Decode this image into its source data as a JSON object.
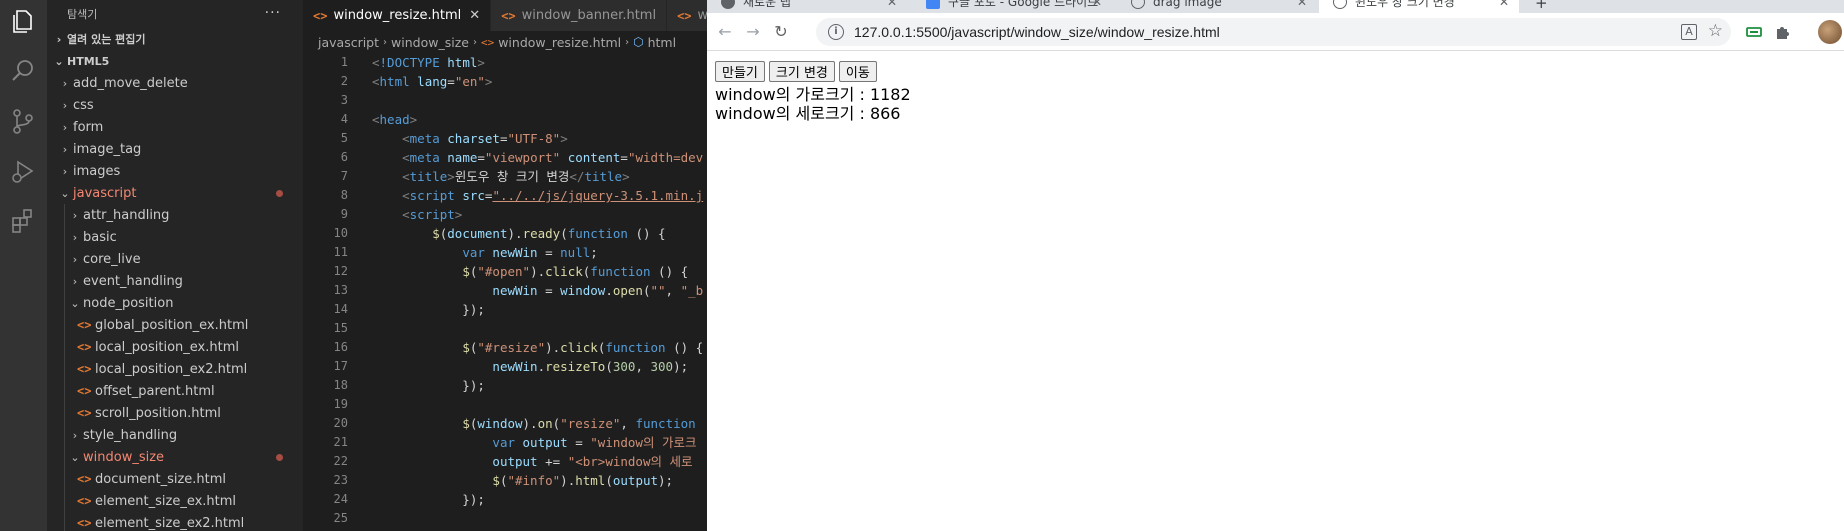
{
  "vscode": {
    "sidebar": {
      "title": "탐색기",
      "more": "···",
      "open_editors": "열려 있는 편집기",
      "root": "HTML5",
      "items": [
        {
          "label": "add_move_delete",
          "type": "folder",
          "depth": 1,
          "open": false
        },
        {
          "label": "css",
          "type": "folder",
          "depth": 1,
          "open": false
        },
        {
          "label": "form",
          "type": "folder",
          "depth": 1,
          "open": false
        },
        {
          "label": "image_tag",
          "type": "folder",
          "depth": 1,
          "open": false
        },
        {
          "label": "images",
          "type": "folder",
          "depth": 1,
          "open": false
        },
        {
          "label": "javascript",
          "type": "folder",
          "depth": 1,
          "open": true,
          "modified": true
        },
        {
          "label": "attr_handling",
          "type": "folder",
          "depth": 2,
          "open": false
        },
        {
          "label": "basic",
          "type": "folder",
          "depth": 2,
          "open": false
        },
        {
          "label": "core_live",
          "type": "folder",
          "depth": 2,
          "open": false
        },
        {
          "label": "event_handling",
          "type": "folder",
          "depth": 2,
          "open": false
        },
        {
          "label": "node_position",
          "type": "folder",
          "depth": 2,
          "open": true
        },
        {
          "label": "global_position_ex.html",
          "type": "file",
          "depth": 3
        },
        {
          "label": "local_position_ex.html",
          "type": "file",
          "depth": 3
        },
        {
          "label": "local_position_ex2.html",
          "type": "file",
          "depth": 3
        },
        {
          "label": "offset_parent.html",
          "type": "file",
          "depth": 3
        },
        {
          "label": "scroll_position.html",
          "type": "file",
          "depth": 3
        },
        {
          "label": "style_handling",
          "type": "folder",
          "depth": 2,
          "open": false
        },
        {
          "label": "window_size",
          "type": "folder",
          "depth": 2,
          "open": true,
          "modified": true
        },
        {
          "label": "document_size.html",
          "type": "file",
          "depth": 3
        },
        {
          "label": "element_size_ex.html",
          "type": "file",
          "depth": 3
        },
        {
          "label": "element_size_ex2.html",
          "type": "file",
          "depth": 3
        }
      ]
    },
    "tabs": [
      {
        "label": "window_resize.html",
        "active": true,
        "close": "✕"
      },
      {
        "label": "window_banner.html",
        "active": false
      },
      {
        "label": "wi",
        "active": false
      }
    ],
    "breadcrumb": [
      "javascript",
      "window_size",
      "window_resize.html",
      "html"
    ],
    "code_lines": [
      [
        [
          "t-punc",
          "<"
        ],
        [
          "t-tag",
          "!DOCTYPE "
        ],
        [
          "t-attr",
          "html"
        ],
        [
          "t-punc",
          ">"
        ]
      ],
      [
        [
          "t-punc",
          "<"
        ],
        [
          "t-tag",
          "html "
        ],
        [
          "t-attr",
          "lang"
        ],
        [
          "t-txt",
          "="
        ],
        [
          "t-str",
          "\"en\""
        ],
        [
          "t-punc",
          ">"
        ]
      ],
      [],
      [
        [
          "t-punc",
          "<"
        ],
        [
          "t-tag",
          "head"
        ],
        [
          "t-punc",
          ">"
        ]
      ],
      [
        [
          "t-txt",
          "    "
        ],
        [
          "t-punc",
          "<"
        ],
        [
          "t-tag",
          "meta "
        ],
        [
          "t-attr",
          "charset"
        ],
        [
          "t-txt",
          "="
        ],
        [
          "t-str",
          "\"UTF-8\""
        ],
        [
          "t-punc",
          ">"
        ]
      ],
      [
        [
          "t-txt",
          "    "
        ],
        [
          "t-punc",
          "<"
        ],
        [
          "t-tag",
          "meta "
        ],
        [
          "t-attr",
          "name"
        ],
        [
          "t-txt",
          "="
        ],
        [
          "t-str",
          "\"viewport\" "
        ],
        [
          "t-attr",
          "content"
        ],
        [
          "t-txt",
          "="
        ],
        [
          "t-str",
          "\"width=dev"
        ]
      ],
      [
        [
          "t-txt",
          "    "
        ],
        [
          "t-punc",
          "<"
        ],
        [
          "t-tag",
          "title"
        ],
        [
          "t-punc",
          ">"
        ],
        [
          "t-txt",
          "윈도우 창 크기 변경"
        ],
        [
          "t-punc",
          "</"
        ],
        [
          "t-tag",
          "title"
        ],
        [
          "t-punc",
          ">"
        ]
      ],
      [
        [
          "t-txt",
          "    "
        ],
        [
          "t-punc",
          "<"
        ],
        [
          "t-tag",
          "script "
        ],
        [
          "t-attr",
          "src"
        ],
        [
          "t-txt",
          "="
        ],
        [
          "t-link",
          "\"../../js/jquery-3.5.1.min.j"
        ]
      ],
      [
        [
          "t-txt",
          "    "
        ],
        [
          "t-punc",
          "<"
        ],
        [
          "t-tag",
          "script"
        ],
        [
          "t-punc",
          ">"
        ]
      ],
      [
        [
          "t-txt",
          "        "
        ],
        [
          "t-fn",
          "$"
        ],
        [
          "t-txt",
          "("
        ],
        [
          "t-var",
          "document"
        ],
        [
          "t-txt",
          ")."
        ],
        [
          "t-fn",
          "ready"
        ],
        [
          "t-txt",
          "("
        ],
        [
          "t-kw",
          "function"
        ],
        [
          "t-txt",
          " () {"
        ]
      ],
      [
        [
          "t-txt",
          "            "
        ],
        [
          "t-kw",
          "var "
        ],
        [
          "t-var",
          "newWin"
        ],
        [
          "t-txt",
          " = "
        ],
        [
          "t-kw",
          "null"
        ],
        [
          "t-txt",
          ";"
        ]
      ],
      [
        [
          "t-txt",
          "            "
        ],
        [
          "t-fn",
          "$"
        ],
        [
          "t-txt",
          "("
        ],
        [
          "t-str",
          "\"#open\""
        ],
        [
          "t-txt",
          ")."
        ],
        [
          "t-fn",
          "click"
        ],
        [
          "t-txt",
          "("
        ],
        [
          "t-kw",
          "function"
        ],
        [
          "t-txt",
          " () {"
        ]
      ],
      [
        [
          "t-txt",
          "                "
        ],
        [
          "t-var",
          "newWin"
        ],
        [
          "t-txt",
          " = "
        ],
        [
          "t-var",
          "window"
        ],
        [
          "t-txt",
          "."
        ],
        [
          "t-fn",
          "open"
        ],
        [
          "t-txt",
          "("
        ],
        [
          "t-str",
          "\"\""
        ],
        [
          "t-txt",
          ", "
        ],
        [
          "t-str",
          "\"_b"
        ]
      ],
      [
        [
          "t-txt",
          "            });"
        ]
      ],
      [],
      [
        [
          "t-txt",
          "            "
        ],
        [
          "t-fn",
          "$"
        ],
        [
          "t-txt",
          "("
        ],
        [
          "t-str",
          "\"#resize\""
        ],
        [
          "t-txt",
          ")."
        ],
        [
          "t-fn",
          "click"
        ],
        [
          "t-txt",
          "("
        ],
        [
          "t-kw",
          "function"
        ],
        [
          "t-txt",
          " () {"
        ]
      ],
      [
        [
          "t-txt",
          "                "
        ],
        [
          "t-var",
          "newWin"
        ],
        [
          "t-txt",
          "."
        ],
        [
          "t-fn",
          "resizeTo"
        ],
        [
          "t-txt",
          "("
        ],
        [
          "t-num",
          "300"
        ],
        [
          "t-txt",
          ", "
        ],
        [
          "t-num",
          "300"
        ],
        [
          "t-txt",
          ");"
        ]
      ],
      [
        [
          "t-txt",
          "            });"
        ]
      ],
      [],
      [
        [
          "t-txt",
          "            "
        ],
        [
          "t-fn",
          "$"
        ],
        [
          "t-txt",
          "("
        ],
        [
          "t-var",
          "window"
        ],
        [
          "t-txt",
          ")."
        ],
        [
          "t-fn",
          "on"
        ],
        [
          "t-txt",
          "("
        ],
        [
          "t-str",
          "\"resize\""
        ],
        [
          "t-txt",
          ", "
        ],
        [
          "t-kw",
          "function"
        ]
      ],
      [
        [
          "t-txt",
          "                "
        ],
        [
          "t-kw",
          "var "
        ],
        [
          "t-var",
          "output"
        ],
        [
          "t-txt",
          " = "
        ],
        [
          "t-str",
          "\"window의 가로크"
        ]
      ],
      [
        [
          "t-txt",
          "                "
        ],
        [
          "t-var",
          "output"
        ],
        [
          "t-txt",
          " += "
        ],
        [
          "t-str",
          "\"<br>window의 세로"
        ]
      ],
      [
        [
          "t-txt",
          "                "
        ],
        [
          "t-fn",
          "$"
        ],
        [
          "t-txt",
          "("
        ],
        [
          "t-str",
          "\"#info\""
        ],
        [
          "t-txt",
          ")."
        ],
        [
          "t-fn",
          "html"
        ],
        [
          "t-txt",
          "("
        ],
        [
          "t-var",
          "output"
        ],
        [
          "t-txt",
          ");"
        ]
      ],
      [
        [
          "t-txt",
          "            });"
        ]
      ],
      []
    ]
  },
  "chrome": {
    "tabs": [
      {
        "label": "새로운 탭",
        "favicon_color": "#5f6368"
      },
      {
        "label": "구글 포토 - Google 드라이브",
        "favicon_color": "#4285f4"
      },
      {
        "label": "drag image",
        "favicon_color": "#5f6368"
      },
      {
        "label": "윈도우 창 크기 변경",
        "favicon_color": "#5f6368",
        "active": true
      }
    ],
    "new_tab": "+",
    "url": "127.0.0.1:5500/javascript/window_size/window_resize.html",
    "page": {
      "buttons": [
        "만들기",
        "크기 변경",
        "이동"
      ],
      "info_line1": "window의 가로크기 : 1182",
      "info_line2": "window의 세로크기 : 866"
    }
  }
}
